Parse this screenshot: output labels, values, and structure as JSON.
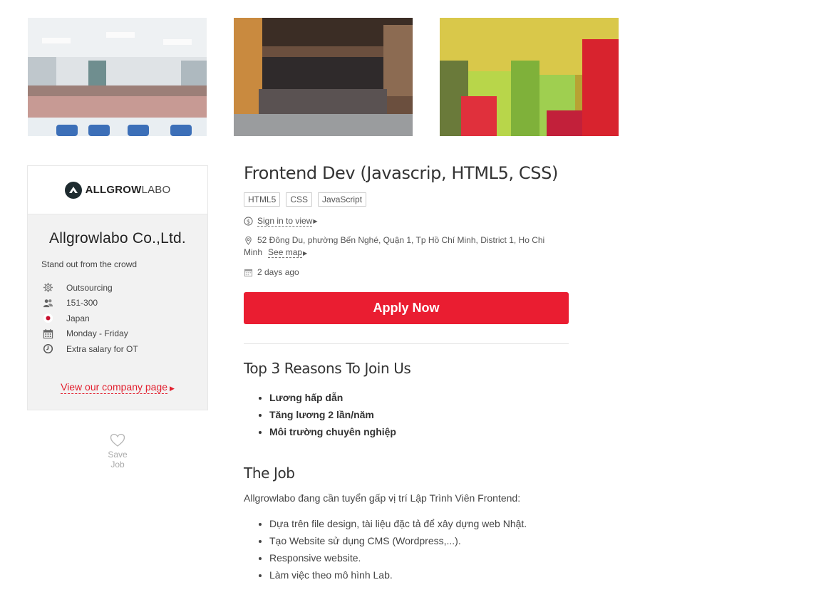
{
  "photos": [
    {
      "alt": "Team photo in office"
    },
    {
      "alt": "Team photo in lounge"
    },
    {
      "alt": "Team in ao dai with flowers"
    }
  ],
  "company": {
    "logo_text_main": "ALLGROW",
    "logo_text_sub": "LABO",
    "name": "Allgrowlabo Co.,Ltd.",
    "tagline": "Stand out from the crowd",
    "facts": [
      {
        "icon": "gear-icon",
        "text": "Outsourcing"
      },
      {
        "icon": "people-icon",
        "text": "151-300"
      },
      {
        "icon": "japan-flag-icon",
        "text": "Japan"
      },
      {
        "icon": "calendar-icon",
        "text": "Monday - Friday"
      },
      {
        "icon": "clock-icon",
        "text": "Extra salary for OT"
      }
    ],
    "link_label": "View our company page"
  },
  "save_job_label": "Save Job",
  "job": {
    "title": "Frontend Dev (Javascrip, HTML5, CSS)",
    "tags": [
      "HTML5",
      "CSS",
      "JavaScript"
    ],
    "salary_link": "Sign in to view",
    "address": "52 Đông Du, phường Bến Nghé, Quận 1, Tp Hồ Chí Minh, District 1, Ho Chi Minh",
    "see_map": "See map",
    "posted": "2 days ago",
    "apply_label": "Apply Now"
  },
  "reasons": {
    "title": "Top 3 Reasons To Join Us",
    "items": [
      "Lương hấp dẫn",
      "Tăng lương 2 lần/năm",
      "Môi trường chuyên nghiệp"
    ]
  },
  "the_job": {
    "title": "The Job",
    "intro": "Allgrowlabo đang cần tuyển gấp vị trí Lập Trình Viên Frontend:",
    "items": [
      "Dựa trên file design, tài liệu đặc tả để xây dựng web Nhật.",
      "Tạo Website sử dụng CMS (Wordpress,...).",
      "Responsive website.",
      "Làm việc theo mô hình Lab."
    ]
  },
  "colors": {
    "accent": "#ea1d31",
    "card_bg": "#f2f2f2"
  }
}
